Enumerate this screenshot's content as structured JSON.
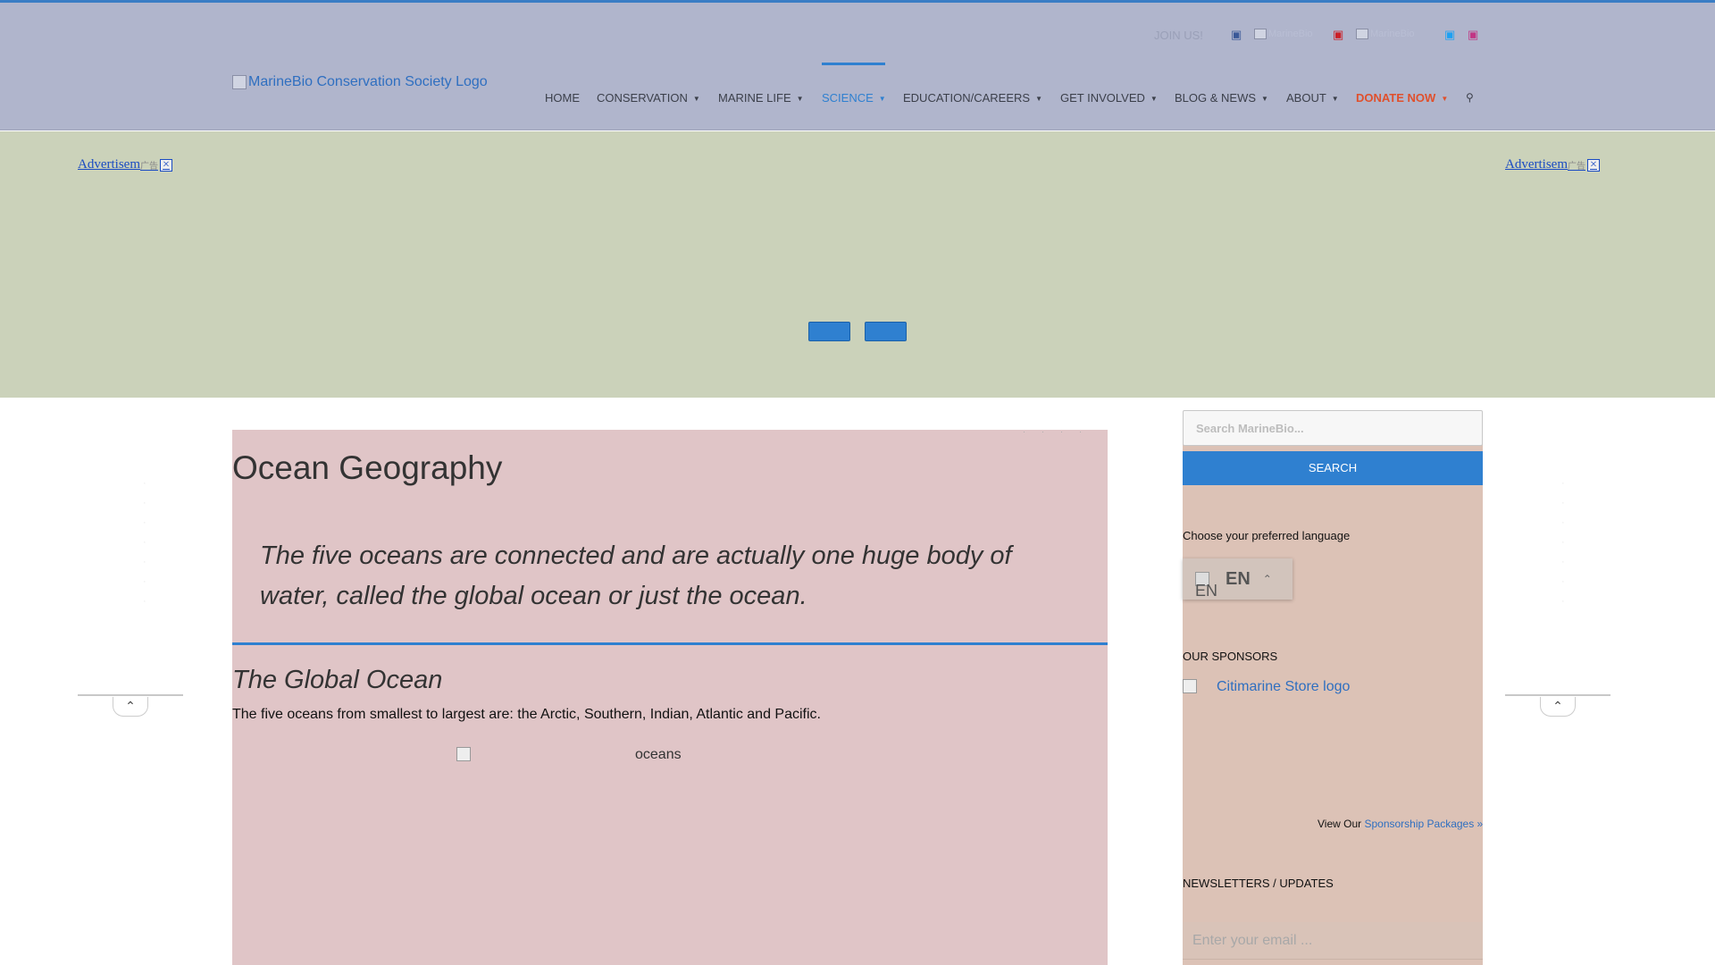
{
  "topbar": {
    "join_label": "JOIN US!",
    "social": [
      {
        "icon": "facebook-icon",
        "color": "#3b5998"
      },
      {
        "icon": "image-placeholder",
        "alt": "MarineBio"
      },
      {
        "icon": "pinterest-icon",
        "color": "#cb2027"
      },
      {
        "icon": "image-placeholder",
        "alt": "MarineBio"
      },
      {
        "icon": "twitter-icon",
        "color": "#1da1f2"
      },
      {
        "icon": "instagram-icon",
        "color": "#c13584"
      }
    ]
  },
  "navbar": {
    "logo_alt": "MarineBio Conservation Society Logo",
    "items": [
      {
        "label": "HOME"
      },
      {
        "label": "CONSERVATION"
      },
      {
        "label": "MARINE LIFE"
      },
      {
        "label": "SCIENCE"
      },
      {
        "label": "EDUCATION/CAREERS"
      },
      {
        "label": "GET INVOLVED"
      },
      {
        "label": "BLOG & NEWS"
      },
      {
        "label": "ABOUT"
      },
      {
        "label": "DONATE NOW"
      }
    ],
    "search_icon": "search-icon",
    "colors": {
      "active": "#2f80d0",
      "donate": "#e0502c"
    }
  },
  "hero": {
    "ad_left": "Advertisement",
    "ad_right": "Advertisement",
    "ad_mini": "广告"
  },
  "main": {
    "title": "Ocean Geography",
    "lead": "The five oceans are connected and are actually one huge body of water, called the global ocean or just the ocean.",
    "section_title": "The Global Ocean",
    "paragraph": "The five oceans from smallest to largest are: the Arctic, Southern, Indian, Atlantic and Pacific.",
    "image_alt": "oceans"
  },
  "sidebar": {
    "search_placeholder": "Search MarineBio...",
    "search_button": "SEARCH",
    "language_label": "Choose your preferred language",
    "language_code": "EN",
    "sponsors_label": "OUR SPONSORS",
    "sponsor_alt": "Citimarine Store logo",
    "view_our": "View Our ",
    "sponsorship_link": "Sponsorship Packages »",
    "newsletters_label": "NEWSLETTERS / UPDATES",
    "email_placeholder": "Enter your email ..."
  }
}
